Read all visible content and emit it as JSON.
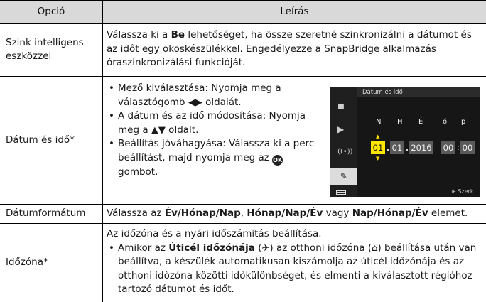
{
  "header": {
    "col1": "Opció",
    "col2": "Leírás"
  },
  "rows": [
    {
      "label": "Szink intelligens eszközzel",
      "desc_pre": "Válassza ki a ",
      "desc_bold": "Be",
      "desc_post": " lehetőséget, ha össze szeretné szinkronizálni a dátumot és az időt egy okoskészülékkel. Engedélyezze a SnapBridge alkalmazás óraszinkronizálási funkcióját."
    },
    {
      "label": "Dátum és idő*",
      "b1_pre": "Mező kiválasztása: Nyomja meg a választógomb ",
      "b1_glyph": "◀▶",
      "b1_post": " oldalát.",
      "b2_pre": "A dátum és az idő módosítása: Nyomja meg a ",
      "b2_glyph": "▲▼",
      "b2_post": " oldalt.",
      "b3_pre": "Beállítás jóváhagyása: Válassza ki a perc beállítást, majd nyomja meg az ",
      "b3_glyph": "OK",
      "b3_post": " gombot.",
      "camera": {
        "title": "Dátum és idő",
        "labels": [
          "N",
          "H",
          "É",
          "ó",
          "p"
        ],
        "values": [
          "01",
          "01",
          "2016",
          "00",
          "00"
        ],
        "footer": "Szerk.",
        "sidebar_icons": [
          "camera-icon",
          "movie-camera-icon",
          "wireless-icon",
          "wrench-icon",
          "battery-icon"
        ]
      }
    },
    {
      "label": "Dátumformátum",
      "t_pre": "Válassza az ",
      "t_b1": "Év/Hónap/Nap",
      "t_sep1": ", ",
      "t_b2": "Hónap/Nap/Év",
      "t_sep2": " vagy ",
      "t_b3": "Nap/Hónap/Év",
      "t_post": " elemet."
    },
    {
      "label": "Időzóna*",
      "intro": "Az időzóna és a nyári időszámítás beállítása.",
      "b_pre": "Amikor az ",
      "b_bold": "Úticél időzónája",
      "b_mid1": " (",
      "b_glyph1": "✈",
      "b_mid2": ") az otthoni időzóna (",
      "b_glyph2": "⌂",
      "b_post": ") beállítása után van beállítva, a készülék automatikusan kiszámolja az úticél időzónája és az otthoni időzóna közötti időkülönbséget, és elmenti a kiválasztott régióhoz tartozó dátumot és időt."
    }
  ],
  "colors": {
    "header_bg": "#d9d9d9",
    "camera_highlight": "#ffe600"
  }
}
